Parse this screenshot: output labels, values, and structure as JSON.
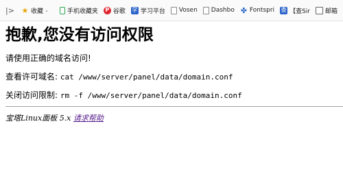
{
  "bookmarks": {
    "items": [
      {
        "label": "收藏",
        "icon": "star-icon"
      },
      {
        "label": "手机收藏夹",
        "icon": "phone-icon"
      },
      {
        "label": "谷歌",
        "icon": "p-icon"
      },
      {
        "label": "学习平台",
        "icon": "study-icon"
      },
      {
        "label": "Vosen",
        "icon": "document-icon"
      },
      {
        "label": "Dashbo",
        "icon": "document-icon"
      },
      {
        "label": "Fontspri",
        "icon": "font-icon"
      },
      {
        "label": "【查Sir",
        "icon": "sir-icon"
      },
      {
        "label": "邮箱",
        "icon": "mail-icon"
      }
    ]
  },
  "page": {
    "heading": "抱歉,您没有访问权限",
    "line1": "请使用正确的域名访问!",
    "line2_label": "查看许可域名: ",
    "line2_cmd": "cat /www/server/panel/data/domain.conf",
    "line3_label": "关闭访问限制: ",
    "line3_cmd": "rm -f /www/server/panel/data/domain.conf",
    "footer_text": "宝塔Linux面板 5.x ",
    "footer_link": "请求帮助"
  }
}
